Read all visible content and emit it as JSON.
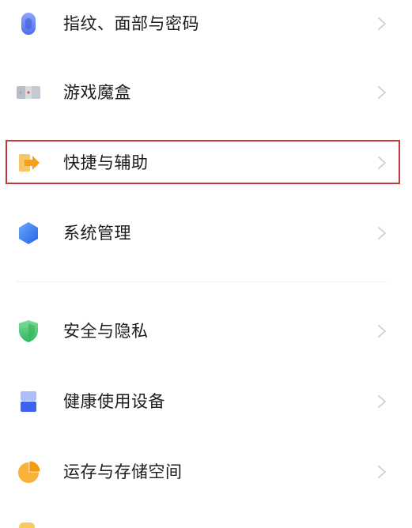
{
  "settings_list": {
    "items": [
      {
        "id": "fingerprint",
        "label": "指纹、面部与密码",
        "icon": "fingerprint-icon",
        "icon_color": "#5b7cf3"
      },
      {
        "id": "game",
        "label": "游戏魔盒",
        "icon": "game-box-icon",
        "icon_color": "#c9ced6"
      },
      {
        "id": "shortcut",
        "label": "快捷与辅助",
        "icon": "shortcut-arrow-icon",
        "icon_color": "#f7a21a"
      },
      {
        "id": "system",
        "label": "系统管理",
        "icon": "hexagon-system-icon",
        "icon_color": "#2f78f0"
      },
      {
        "id": "security",
        "label": "安全与隐私",
        "icon": "shield-icon",
        "icon_color": "#3cbf6a"
      },
      {
        "id": "health",
        "label": "健康使用设备",
        "icon": "hourglass-icon",
        "icon_color": "#4a6ff2"
      },
      {
        "id": "storage",
        "label": "运存与存储空间",
        "icon": "pie-chart-icon",
        "icon_color": "#f7ab2e"
      }
    ],
    "chevron_icon": "chevron-right-icon",
    "highlight_color": "#c9363a"
  }
}
